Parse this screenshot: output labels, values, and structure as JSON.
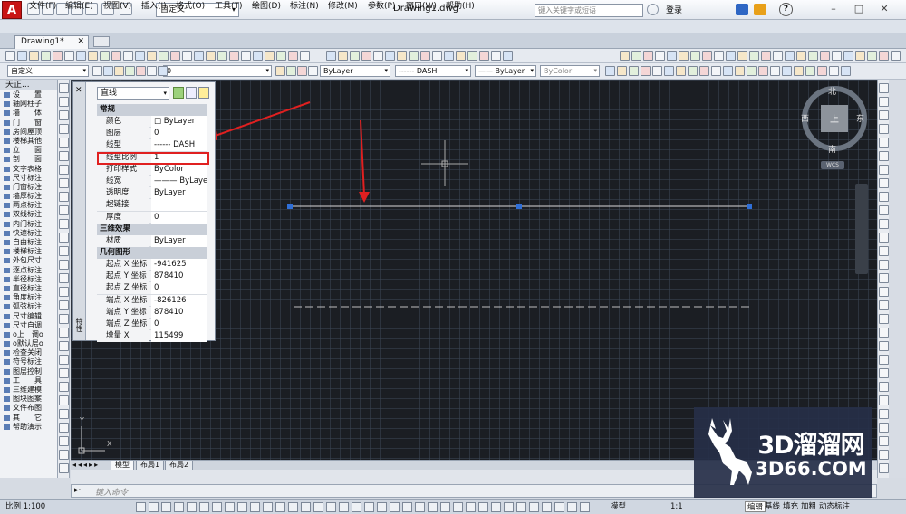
{
  "app": {
    "logo": "A",
    "workspace": "自定义",
    "doc_title": "Drawing1.dwg",
    "search_placeholder": "键入关键字或短语",
    "login": "登录",
    "help": "?"
  },
  "menu": [
    "文件(F)",
    "编辑(E)",
    "视图(V)",
    "插入(I)",
    "格式(O)",
    "工具(T)",
    "绘图(D)",
    "标注(N)",
    "修改(M)",
    "参数(P)",
    "窗口(W)",
    "帮助(H)"
  ],
  "tabs": {
    "file": "Drawing1*"
  },
  "toolbar": {
    "workspace2": "自定义",
    "layer_num": "0",
    "color": "ByLayer",
    "linetype": "------ DASH",
    "lineweight": "—— ByLayer",
    "plotstyle": "ByColor"
  },
  "left_panel": {
    "title": "天正...",
    "items": [
      "设　　置",
      "轴网柱子",
      "墙　　体",
      "门　　窗",
      "房间屋顶",
      "楼梯其他",
      "立　　面",
      "剖　　面",
      "文字表格",
      "尺寸标注",
      "门窗标注",
      "墙厚标注",
      "两点标注",
      "双线标注",
      "内门标注",
      "快速标注",
      "自由标注",
      "楼梯标注",
      "外包尺寸",
      "逐点标注",
      "半径标注",
      "直径标注",
      "角度标注",
      "弧弦标注",
      "尺寸编辑",
      "尺寸自调",
      "o上　调o",
      "o默认层o",
      "检查关闭",
      "符号标注",
      "图层控制",
      "工　　具",
      "三维建模",
      "图块图案",
      "文件布图",
      "其　　它",
      "帮助演示"
    ]
  },
  "properties": {
    "selection": "直线",
    "panel_title": "特性",
    "sections": [
      {
        "name": "常规",
        "rows": [
          [
            "颜色",
            "□ ByLayer"
          ],
          [
            "图层",
            "0"
          ],
          [
            "线型",
            "------ DASH"
          ],
          [
            "线型比例",
            "1"
          ],
          [
            "打印样式",
            "ByColor"
          ],
          [
            "线宽",
            "——— ByLayer"
          ],
          [
            "透明度",
            "ByLayer"
          ],
          [
            "超链接",
            ""
          ],
          [
            "厚度",
            "0"
          ]
        ]
      },
      {
        "name": "三维效果",
        "rows": [
          [
            "材质",
            "ByLayer"
          ]
        ]
      },
      {
        "name": "几何图形",
        "rows": [
          [
            "起点 X 坐标",
            "-941625"
          ],
          [
            "起点 Y 坐标",
            "878410"
          ],
          [
            "起点 Z 坐标",
            "0"
          ],
          [
            "端点 X 坐标",
            "-826126"
          ],
          [
            "端点 Y 坐标",
            "878410"
          ],
          [
            "端点 Z 坐标",
            "0"
          ],
          [
            "增量 X",
            "115499"
          ]
        ]
      }
    ]
  },
  "viewcube": {
    "north": "北",
    "south": "南",
    "east": "东",
    "west": "西",
    "top": "上",
    "wcs": "WCS"
  },
  "ucs": {
    "x": "X",
    "y": "Y"
  },
  "layout_tabs": [
    "模型",
    "布局1",
    "布局2"
  ],
  "command": {
    "placeholder": "键入命令"
  },
  "status": {
    "scale_left": "比例 1:100",
    "model": "模型",
    "scale": "1:1",
    "items": [
      "编辑",
      "基线",
      "填充",
      "加粗",
      "动态标注"
    ]
  },
  "watermark": {
    "line1": "3D溜溜网",
    "line2": "3D66.COM"
  },
  "colors": {
    "canvas": "#1b1e23",
    "highlight": "#e02020",
    "grip": "#2f6fd8",
    "accent": "#c81414"
  }
}
